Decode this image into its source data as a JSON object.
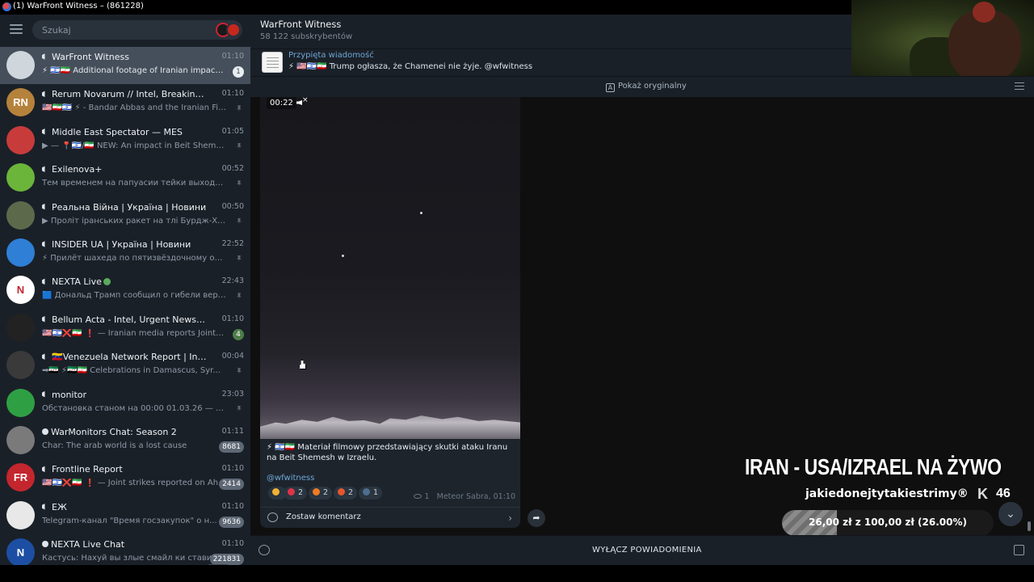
{
  "window": {
    "title": "(1) WarFront Witness – (861228)"
  },
  "search": {
    "placeholder": "Szukaj"
  },
  "chats": [
    {
      "name": "WarFront Witness",
      "time": "01:10",
      "preview": "⚡ 🇮🇱🇮🇷 Additional footage of Iranian impact ...",
      "badge": "1",
      "kind": "channel",
      "active": true,
      "avatar_color": "#cfd6dc"
    },
    {
      "name": "Rerum Novarum // Intel, Breaking News, an...",
      "time": "01:10",
      "preview": "🇺🇸🇮🇷🇮🇱 ⚡ - Bandar Abbas and the Iranian First ...",
      "pinned": true,
      "kind": "channel",
      "avatar_color": "#b5823c",
      "avatar_text": "RN"
    },
    {
      "name": "Middle East Spectator — MES",
      "time": "01:05",
      "preview": "▶ — 📍🇮🇱/🇮🇷 NEW: An impact in Beit Shemesh ...",
      "pinned": true,
      "kind": "channel",
      "avatar_color": "#c83b3b"
    },
    {
      "name": "Exilenova+",
      "time": "00:52",
      "preview": "Тем временем на папуасии тейки выходили ...",
      "pinned": true,
      "kind": "channel",
      "avatar_color": "#6bb53a"
    },
    {
      "name": "Реальна Війна | Україна | Новини",
      "time": "00:50",
      "preview": "▶ Проліт іранських ракет на тлі Бурдж-Халіфи ...",
      "pinned": true,
      "kind": "channel",
      "avatar_color": "#5c6a4b"
    },
    {
      "name": "INSIDER UA | Україна | Новини",
      "time": "22:52",
      "preview": "⚡ Прилёт шахеда по пятизвёздочному отел...",
      "pinned": true,
      "kind": "channel",
      "avatar_color": "#2f7fd6"
    },
    {
      "name": "NEXTA Live",
      "time": "22:43",
      "preview": "🟦 Дональд Трамп сообщил о гибели верхо...",
      "pinned": true,
      "verified": true,
      "kind": "channel",
      "avatar_color": "#ffffff",
      "avatar_text": "N"
    },
    {
      "name": "Bellum Acta - Intel, Urgent News and Archiv...",
      "time": "01:10",
      "preview": "🇺🇸🇮🇱❌🇮🇷 ❗ — Iranian media reports Joint Am...",
      "badge": "4",
      "badge_green": true,
      "kind": "channel",
      "avatar_color": "#222222"
    },
    {
      "name": "🇻🇪Venezuela Network Report | Intel, Urgen...",
      "time": "00:04",
      "preview": "➡🇸🇾 ⚡🇸🇾🇮🇷 Celebrations in Damascus, Syr...",
      "pinned": true,
      "kind": "channel",
      "avatar_color": "#3a3a3a"
    },
    {
      "name": "monitor",
      "time": "23:03",
      "preview": "Обстановка станом на 00:00 01.03.26 — Стр...",
      "pinned": true,
      "kind": "channel",
      "avatar_color": "#2ea043"
    },
    {
      "name": "WarMonitors Chat: Season 2",
      "time": "01:11",
      "preview": "Char: The arab world is a lost cause",
      "badge": "8681",
      "kind": "group",
      "avatar_color": "#7a7a7a"
    },
    {
      "name": "Frontline Report",
      "time": "01:10",
      "preview": "🇺🇸🇮🇱❌🇮🇷 ❗ — Joint strikes reported on Ah...",
      "badge": "2414",
      "kind": "channel",
      "avatar_color": "#c4262e",
      "avatar_text": "FR"
    },
    {
      "name": "ЕЖ",
      "time": "01:10",
      "preview": "Telegram-канал \"Время госзакупок\" о н...",
      "badge": "9636",
      "kind": "channel",
      "avatar_color": "#e8e8e8"
    },
    {
      "name": "NEXTA Live Chat",
      "time": "01:10",
      "preview": "Кастусь: Нахуй вы злые смайл ки ставите. ...",
      "badge": "221831",
      "kind": "group",
      "avatar_color": "#1c4fa3",
      "avatar_text": "N"
    }
  ],
  "channel": {
    "title": "WarFront Witness",
    "subscribers": "58 122 subskrybentów"
  },
  "pinned": {
    "label": "Przypięta wiadomość",
    "text": "⚡ 🇺🇸🇮🇱🇮🇷 Trump ogłasza, że Chamenei nie żyje.  @wfwitness"
  },
  "translate": {
    "show_original": "Pokaż oryginalny"
  },
  "message": {
    "video_time": "00:22",
    "text": "⚡ 🇮🇱🇮🇷 Materiał filmowy przedstawiający skutki ataku Iranu na Beit Shemesh w Izraelu.",
    "link": "@wfwitness",
    "reactions": [
      {
        "icon": "star",
        "count": "",
        "color": "#f2b233"
      },
      {
        "icon": "heart",
        "count": "2",
        "color": "#e0334a"
      },
      {
        "icon": "fire",
        "count": "2",
        "color": "#f07a23"
      },
      {
        "icon": "angry-face",
        "count": "2",
        "color": "#e4572e"
      },
      {
        "icon": "crying-face",
        "count": "1",
        "color": "#4f6d8f"
      }
    ],
    "views": "1",
    "author_time": "Meteor Sabra, 01:10",
    "comment_label": "Zostaw komentarz"
  },
  "overlay": {
    "title": "IRAN - USA/IZRAEL NA ŻYWO",
    "subtitle": "jakiedonejtytakiestrimy®",
    "kick_logo": "K",
    "kick_count": "46",
    "goal_text": "26,00 zł z 100,00 zł (26.00%)",
    "goal_fraction": 0.26
  },
  "bottom": {
    "mute_label": "WYŁĄCZ POWIADOMIENIA"
  }
}
